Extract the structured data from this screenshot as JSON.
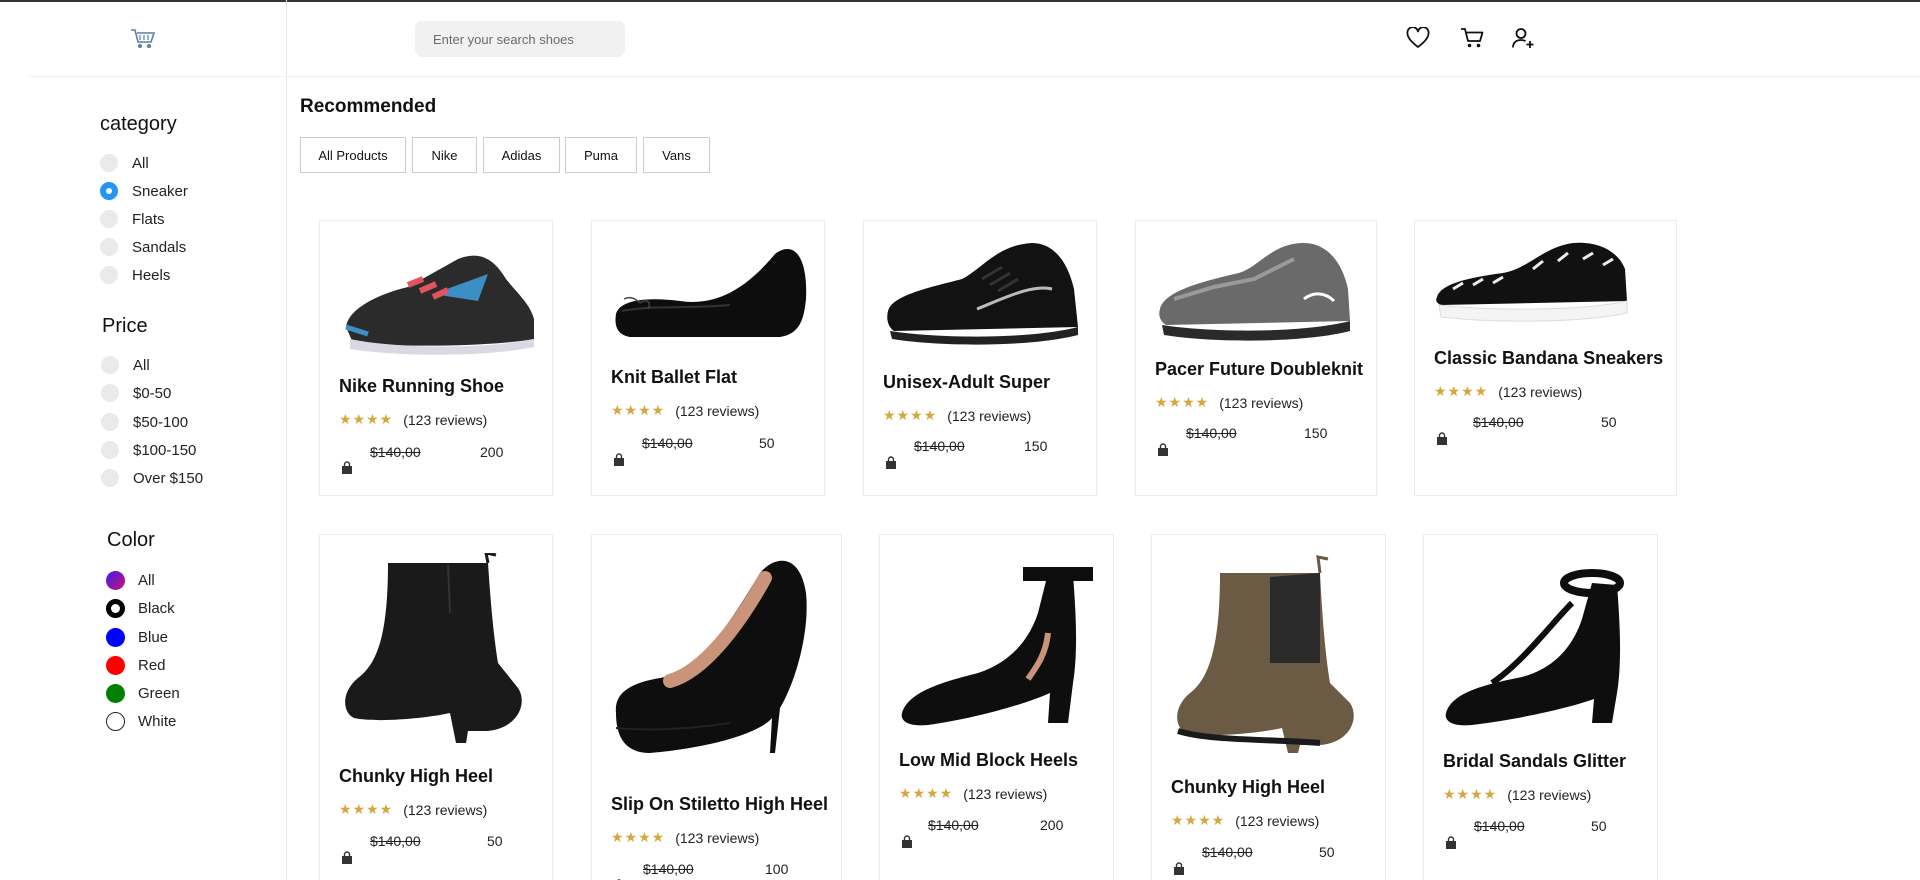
{
  "search": {
    "placeholder": "Enter your search shoes"
  },
  "sidebar": {
    "category_title": "category",
    "categories": [
      "All",
      "Sneaker",
      "Flats",
      "Sandals",
      "Heels"
    ],
    "category_selected": "Sneaker",
    "price_title": "Price",
    "prices": [
      "All",
      "$0-50",
      "$50-100",
      "$100-150",
      "Over $150"
    ],
    "color_title": "Color",
    "colors": [
      {
        "label": "All",
        "swatch": "gradient"
      },
      {
        "label": "Black",
        "swatch": "#000000"
      },
      {
        "label": "Blue",
        "swatch": "#0000ff"
      },
      {
        "label": "Red",
        "swatch": "#ff0000"
      },
      {
        "label": "Green",
        "swatch": "#008000"
      },
      {
        "label": "White",
        "swatch": "#ffffff"
      }
    ]
  },
  "main": {
    "title": "Recommended",
    "filters": [
      "All Products",
      "Nike",
      "Adidas",
      "Puma",
      "Vans"
    ],
    "products": [
      {
        "title": "Nike Running Shoe",
        "stars": "★★★★",
        "reviews": "(123 reviews)",
        "old_price": "$140,00",
        "price": "200"
      },
      {
        "title": "Knit Ballet Flat",
        "stars": "★★★★",
        "reviews": "(123 reviews)",
        "old_price": "$140,00",
        "price": "50"
      },
      {
        "title": "Unisex-Adult Super",
        "stars": "★★★★",
        "reviews": "(123 reviews)",
        "old_price": "$140,00",
        "price": "150"
      },
      {
        "title": "Pacer Future Doubleknit",
        "stars": "★★★★",
        "reviews": "(123 reviews)",
        "old_price": "$140,00",
        "price": "150"
      },
      {
        "title": "Classic Bandana Sneakers",
        "stars": "★★★★",
        "reviews": "(123 reviews)",
        "old_price": "$140,00",
        "price": "50"
      },
      {
        "title": "Chunky High Heel",
        "stars": "★★★★",
        "reviews": "(123 reviews)",
        "old_price": "$140,00",
        "price": "50"
      },
      {
        "title": "Slip On Stiletto High Heel",
        "stars": "★★★★",
        "reviews": "(123 reviews)",
        "old_price": "$140,00",
        "price": "100"
      },
      {
        "title": "Low Mid Block Heels",
        "stars": "★★★★",
        "reviews": "(123 reviews)",
        "old_price": "$140,00",
        "price": "200"
      },
      {
        "title": "Chunky High Heel",
        "stars": "★★★★",
        "reviews": "(123 reviews)",
        "old_price": "$140,00",
        "price": "50"
      },
      {
        "title": "Bridal Sandals Glitter",
        "stars": "★★★★",
        "reviews": "(123 reviews)",
        "old_price": "$140,00",
        "price": "50"
      }
    ]
  },
  "colors": {
    "accent": "#2196f3",
    "star": "#d4a83a",
    "border": "#ececec"
  }
}
